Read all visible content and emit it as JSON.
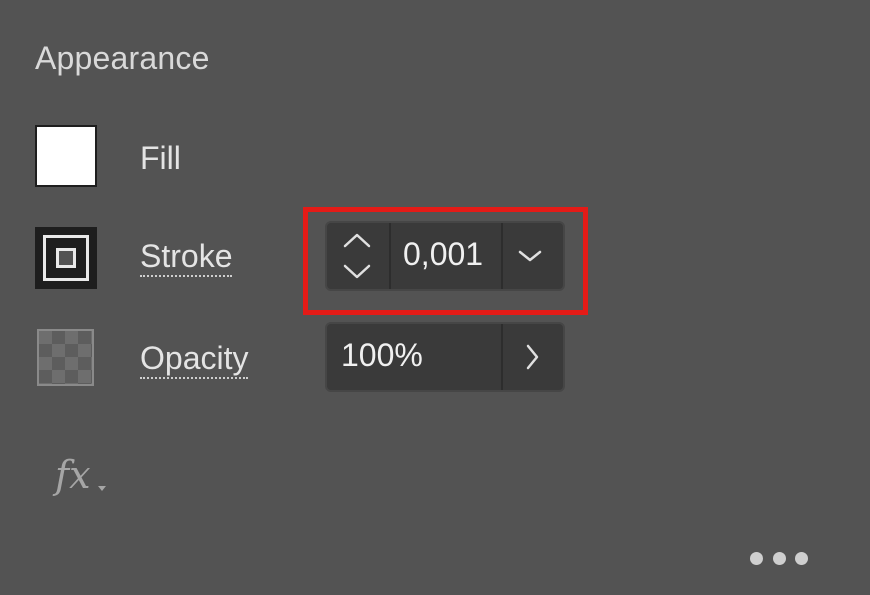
{
  "panel": {
    "title": "Appearance"
  },
  "fill": {
    "label": "Fill",
    "swatch_color": "#ffffff"
  },
  "stroke": {
    "label": "Stroke",
    "weight_value": "0,001",
    "stepper_icon": "up-down-stepper-icon",
    "dropdown_icon": "chevron-down-icon"
  },
  "opacity": {
    "label": "Opacity",
    "value": "100%",
    "arrow_icon": "chevron-right-icon"
  },
  "effects": {
    "label": "fx",
    "icon": "fx-icon"
  },
  "more": {
    "icon": "more-options-icon"
  },
  "colors": {
    "panel_bg": "#535353",
    "highlight": "#e41b17"
  }
}
